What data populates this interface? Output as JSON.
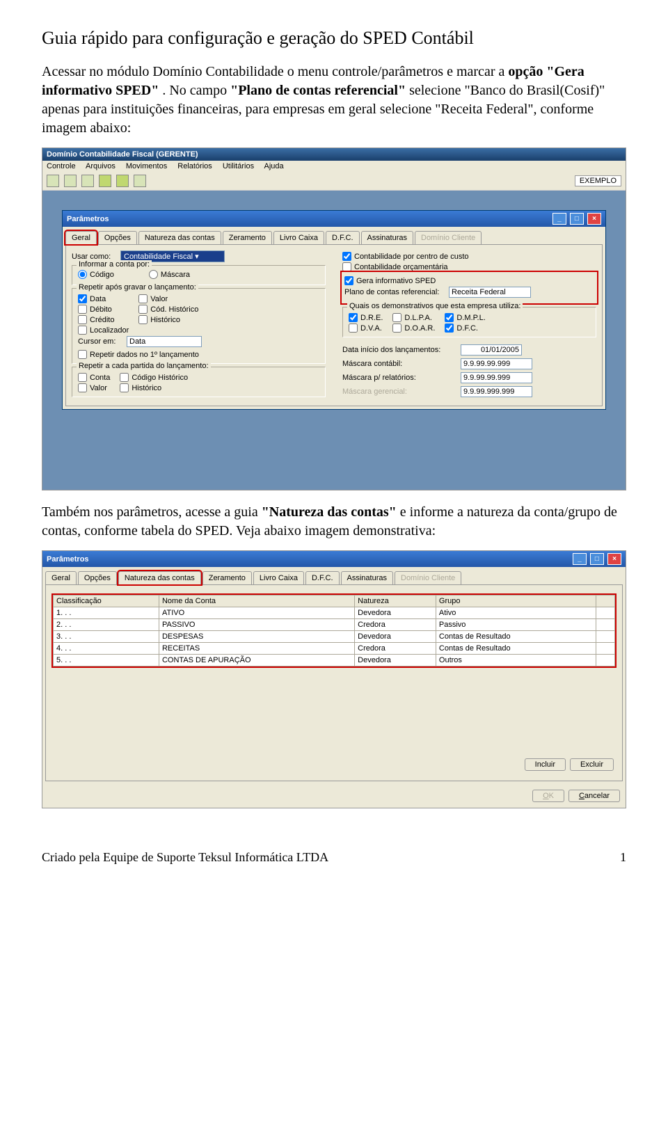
{
  "title": "Guia rápido para configuração e geração do SPED Contábil",
  "para1_prefix": "Acessar no módulo Domínio Contabilidade o menu controle/parâmetros e marcar a ",
  "para1_bold1": "opção \"Gera informativo SPED\"",
  "para1_mid": ". No campo ",
  "para1_bold2": "\"Plano de contas referencial\"",
  "para1_suffix": " selecione \"Banco do Brasil(Cosif)\" apenas para instituições financeiras, para empresas em geral selecione \"Receita Federal\", conforme imagem abaixo:",
  "para2_prefix": "Também nos parâmetros, acesse a guia ",
  "para2_bold1": "\"Natureza das contas\"",
  "para2_suffix": " e informe a natureza da conta/grupo de contas, conforme tabela do SPED. Veja abaixo imagem demonstrativa:",
  "footer_left": "Criado pela Equipe de Suporte Teksul Informática LTDA",
  "footer_right": "1",
  "app": {
    "title": "Domínio Contabilidade Fiscal  (GERENTE)",
    "menus": [
      "Controle",
      "Arquivos",
      "Movimentos",
      "Relatórios",
      "Utilitários",
      "Ajuda"
    ],
    "exemplo": "EXEMPLO"
  },
  "param_window": {
    "title": "Parâmetros",
    "tabs": [
      "Geral",
      "Opções",
      "Natureza das contas",
      "Zeramento",
      "Livro Caixa",
      "D.F.C.",
      "Assinaturas",
      "Domínio Cliente"
    ],
    "usar_como_label": "Usar como:",
    "usar_como_value": "Contabilidade Fiscal",
    "grp_informar": "Informar a conta por:",
    "radio_codigo": "Código",
    "radio_mascara": "Máscara",
    "grp_repetir": "Repetir após gravar o lançamento:",
    "chk_data": "Data",
    "chk_valor": "Valor",
    "chk_debito": "Débito",
    "chk_codhist": "Cód. Histórico",
    "chk_credito": "Crédito",
    "chk_hist": "Histórico",
    "chk_loc": "Localizador",
    "cursor_label": "Cursor em:",
    "cursor_value": "Data",
    "chk_repetir1": "Repetir dados no 1º lançamento",
    "grp_partida": "Repetir a cada partida do lançamento:",
    "chk_conta": "Conta",
    "chk_codhist2": "Código Histórico",
    "chk_valor2": "Valor",
    "chk_hist2": "Histórico",
    "chk_cc": "Contabilidade por centro de custo",
    "chk_orc": "Contabilidade orçamentária",
    "chk_sped": "Gera informativo SPED",
    "plano_label": "Plano de contas referencial:",
    "plano_value": "Receita Federal",
    "grp_demon": "Quais os demonstrativos que esta empresa utiliza:",
    "dre": "D.R.E.",
    "dlpa": "D.L.P.A.",
    "dmpl": "D.M.P.L.",
    "dva": "D.V.A.",
    "doar": "D.O.A.R.",
    "dfc": "D.F.C.",
    "data_inicio_label": "Data início dos lançamentos:",
    "data_inicio": "01/01/2005",
    "masc_cont_label": "Máscara contábil:",
    "masc_cont": "9.9.99.99.999",
    "masc_rel_label": "Máscara p/ relatórios:",
    "masc_rel": "9.9.99.99.999",
    "masc_ger_label": "Máscara gerencial:",
    "masc_ger": "9.9.99.999.999"
  },
  "param2": {
    "title": "Parâmetros",
    "tabs": [
      "Geral",
      "Opções",
      "Natureza das contas",
      "Zeramento",
      "Livro Caixa",
      "D.F.C.",
      "Assinaturas",
      "Domínio Cliente"
    ],
    "headers": [
      "Classificação",
      "Nome da Conta",
      "Natureza",
      "Grupo"
    ],
    "rows": [
      [
        "1. . .",
        "ATIVO",
        "Devedora",
        "Ativo"
      ],
      [
        "2. . .",
        "PASSIVO",
        "Credora",
        "Passivo"
      ],
      [
        "3. . .",
        "DESPESAS",
        "Devedora",
        "Contas de Resultado"
      ],
      [
        "4. . .",
        "RECEITAS",
        "Credora",
        "Contas de Resultado"
      ],
      [
        "5. . .",
        "CONTAS DE APURAÇÃO",
        "Devedora",
        "Outros"
      ]
    ],
    "btn_incluir": "Incluir",
    "btn_excluir": "Excluir",
    "btn_ok": "OK",
    "btn_cancelar": "Cancelar"
  }
}
